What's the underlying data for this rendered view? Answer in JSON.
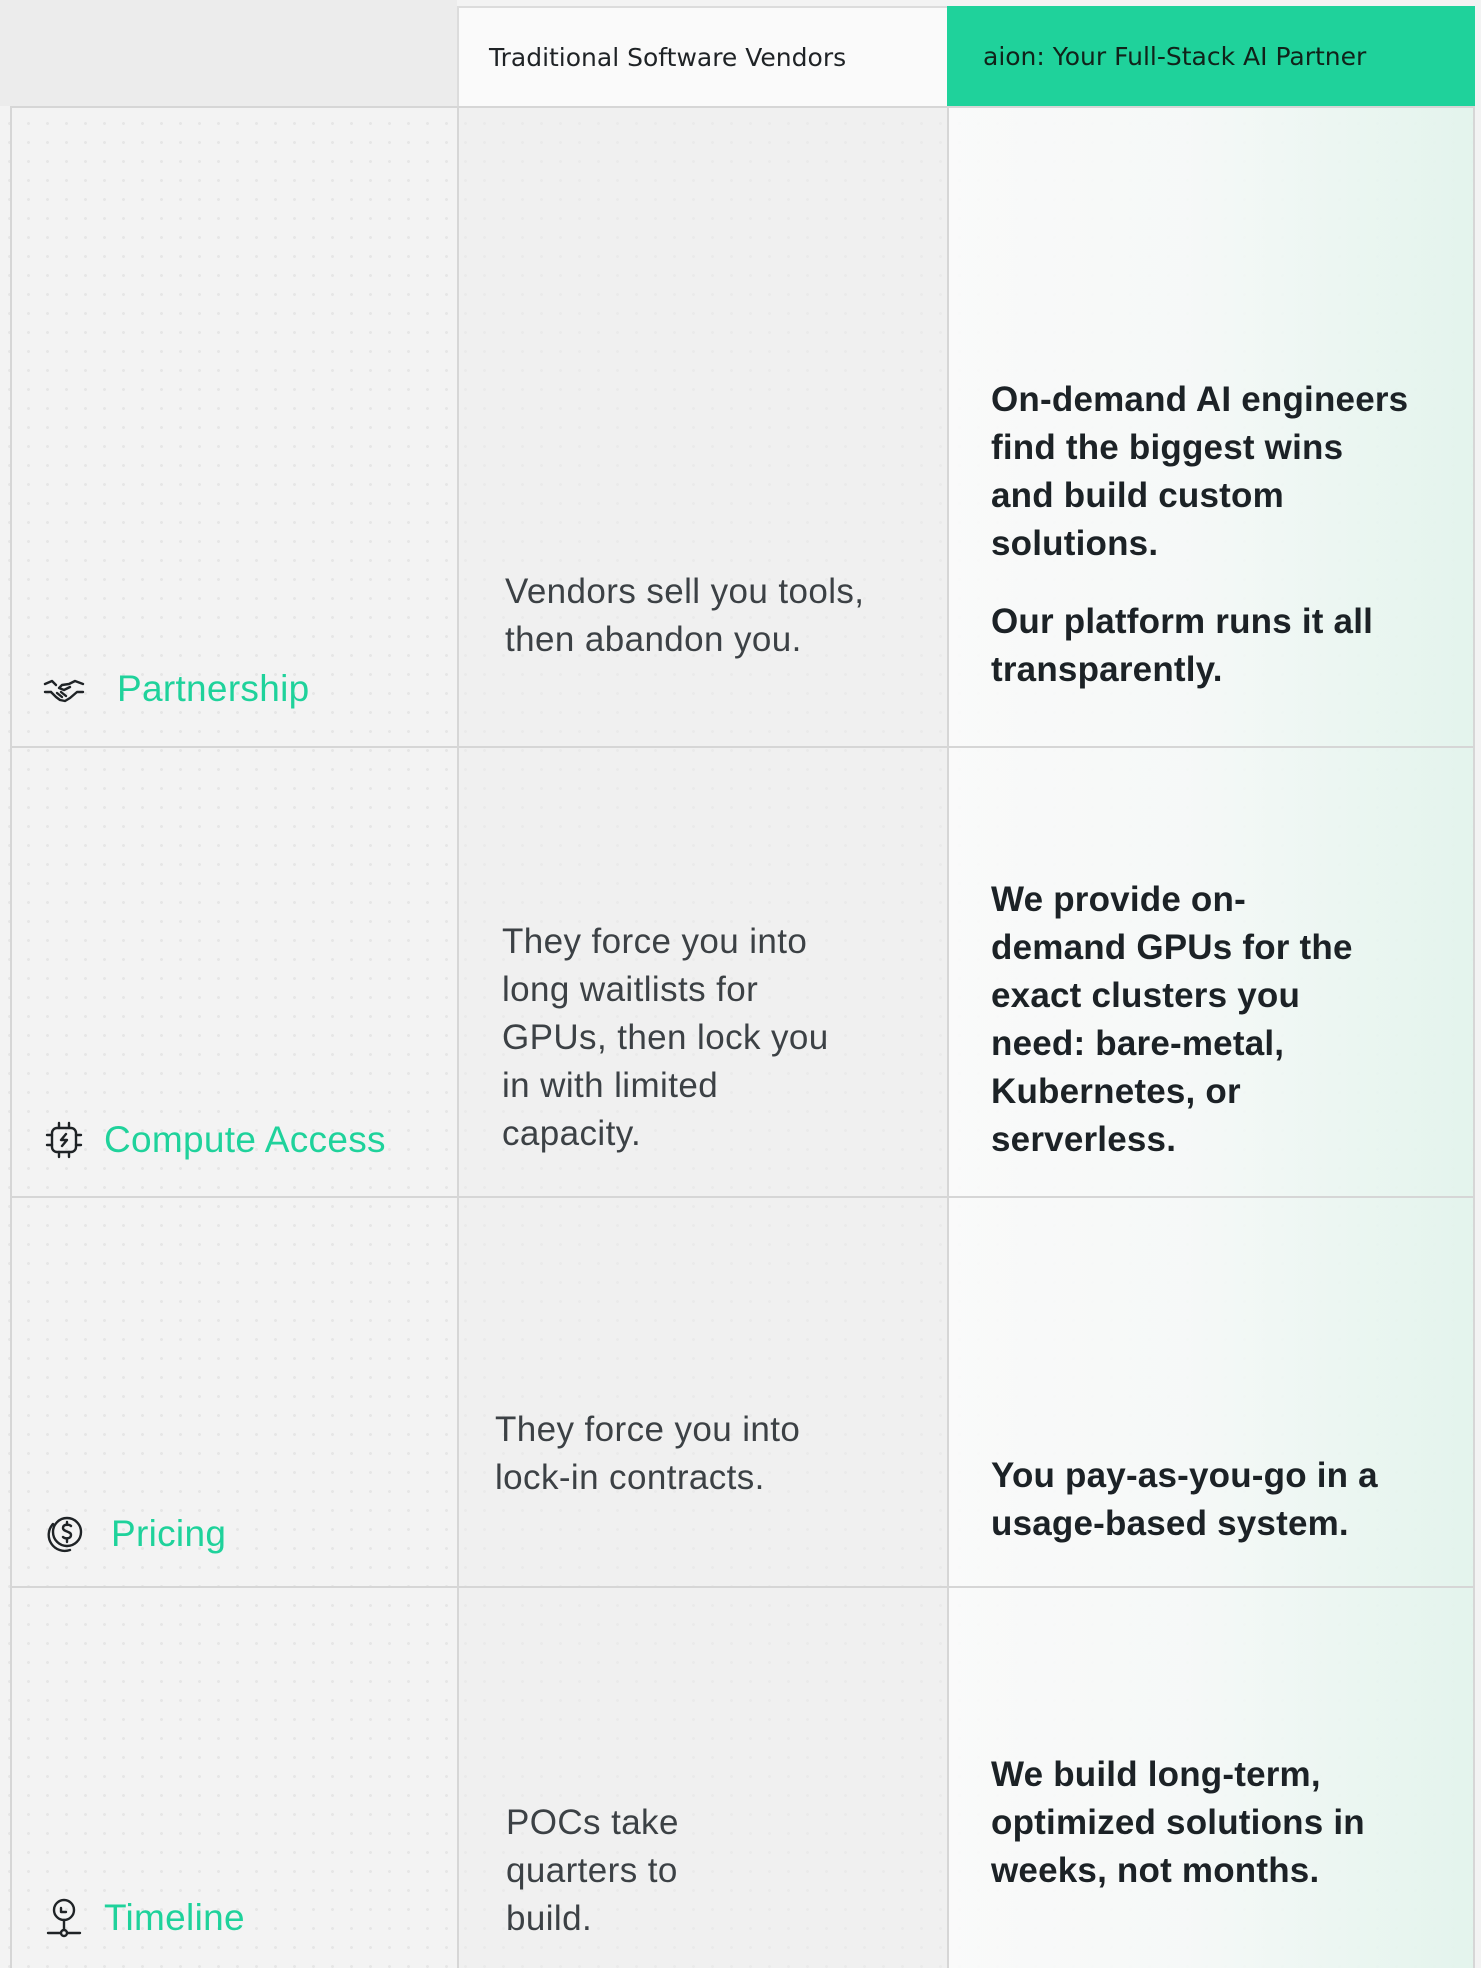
{
  "header": {
    "traditional_label": "Traditional Software Vendors",
    "aion_label": "aion: Your Full-Stack AI Partner"
  },
  "colors": {
    "accent": "#1fd29b",
    "text_dark": "#1c2226",
    "text_muted": "#3c4145",
    "border": "#d6d6d6"
  },
  "rows": [
    {
      "icon": "handshake-icon",
      "label": "Partnership",
      "traditional": "Vendors sell you tools, then abandon you.",
      "aion_paragraphs": [
        "On-demand AI engineers find the biggest wins and build custom solutions.",
        "Our platform runs it all transparently."
      ]
    },
    {
      "icon": "chip-icon",
      "label": "Compute Access",
      "traditional": "They force you into long waitlists for GPUs, then lock you in with limited capacity.",
      "aion_paragraphs": [
        "We provide on-demand GPUs for the exact clusters you need: bare-metal, Kubernetes, or serverless."
      ]
    },
    {
      "icon": "dollar-coin-icon",
      "label": "Pricing",
      "traditional": "They force you into lock-in contracts.",
      "aion_paragraphs": [
        "You pay-as-you-go in a usage-based system."
      ]
    },
    {
      "icon": "location-pin-icon",
      "label": "Timeline",
      "traditional": "POCs take quarters to build.",
      "aion_paragraphs": [
        "We build long-term, optimized solutions in weeks, not months."
      ]
    }
  ]
}
